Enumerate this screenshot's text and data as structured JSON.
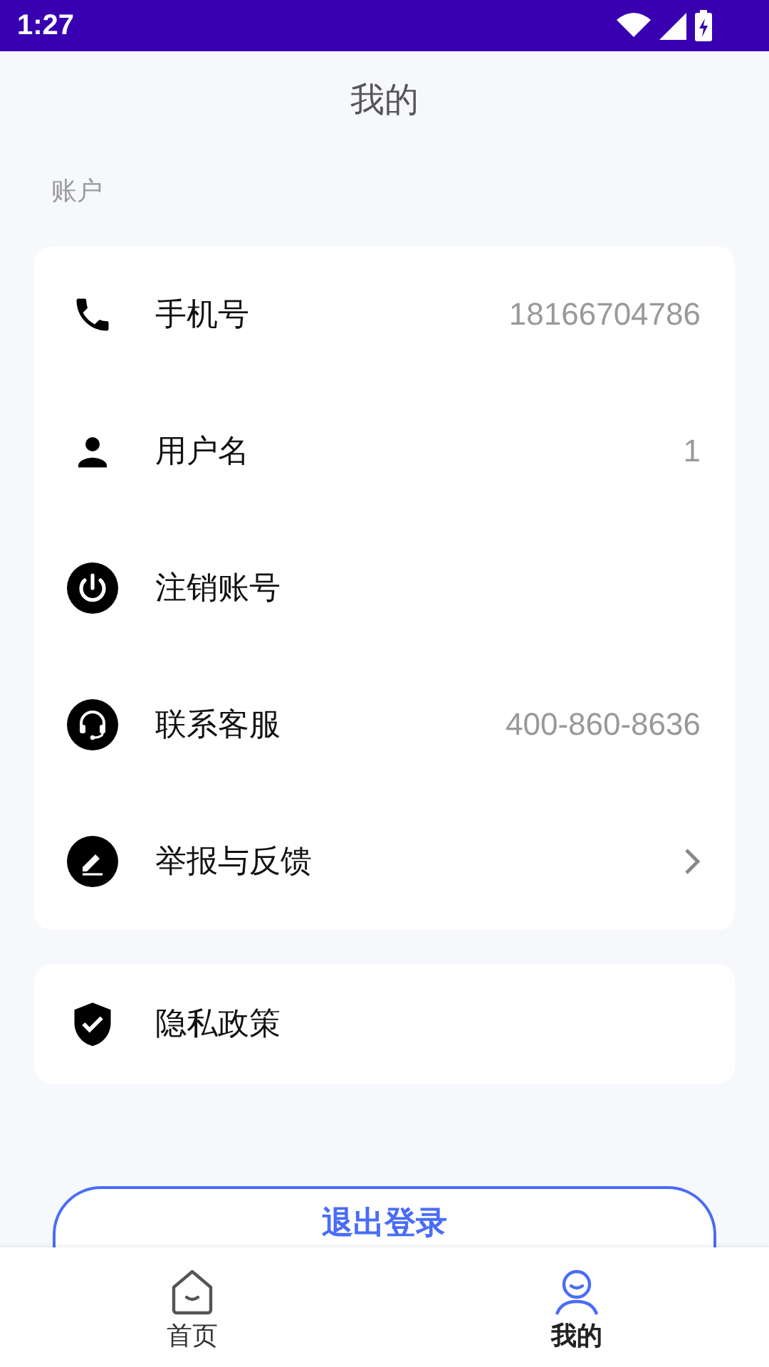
{
  "status_bar": {
    "time": "1:27"
  },
  "title": "我的",
  "section_label": "账户",
  "account_items": [
    {
      "label": "手机号",
      "value": "18166704786"
    },
    {
      "label": "用户名",
      "value": "1"
    },
    {
      "label": "注销账号"
    },
    {
      "label": "联系客服",
      "value": "400-860-8636"
    },
    {
      "label": "举报与反馈",
      "chevron": true
    }
  ],
  "other_items": [
    {
      "label": "隐私政策"
    }
  ],
  "logout_button": "退出登录",
  "tabs": [
    {
      "label": "首页",
      "selected": false
    },
    {
      "label": "我的",
      "selected": true
    }
  ]
}
